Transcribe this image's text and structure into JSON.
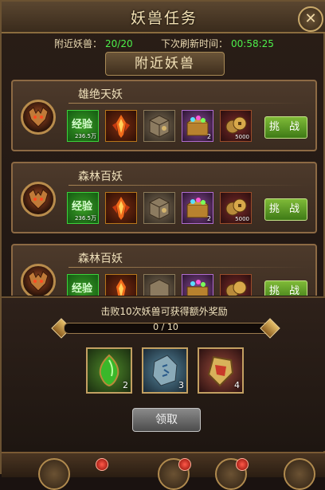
{
  "window": {
    "title": "妖兽任务",
    "close_label": "✕"
  },
  "info": {
    "nearby_label": "附近妖兽：",
    "nearby_value": "20/20",
    "refresh_label": "下次刷新时间：",
    "refresh_value": "00:58:25"
  },
  "section": {
    "title": "附近妖兽"
  },
  "cards": [
    {
      "name": "雄绝天妖",
      "challenge_label": "挑 战",
      "items": [
        {
          "icon": "exp-icon",
          "label": "经验",
          "count": "236.5万"
        },
        {
          "icon": "fire-crystal-icon",
          "count": ""
        },
        {
          "icon": "stone-box-icon",
          "count": ""
        },
        {
          "icon": "gem-chest-icon",
          "count": "2"
        },
        {
          "icon": "coin-icon",
          "count": "5000"
        }
      ]
    },
    {
      "name": "森林百妖",
      "challenge_label": "挑 战",
      "items": [
        {
          "icon": "exp-icon",
          "label": "经验",
          "count": "236.5万"
        },
        {
          "icon": "fire-crystal-icon",
          "count": ""
        },
        {
          "icon": "stone-box-icon",
          "count": ""
        },
        {
          "icon": "gem-chest-icon",
          "count": "2"
        },
        {
          "icon": "coin-icon",
          "count": "5000"
        }
      ]
    },
    {
      "name": "森林百妖",
      "challenge_label": "挑 战",
      "items": [
        {
          "icon": "exp-icon",
          "label": "经验",
          "count": ""
        },
        {
          "icon": "fire-crystal-icon",
          "count": ""
        },
        {
          "icon": "stone-box-icon",
          "count": ""
        },
        {
          "icon": "gem-chest-icon",
          "count": ""
        },
        {
          "icon": "coin-icon",
          "count": ""
        }
      ]
    }
  ],
  "reward": {
    "title": "击败10次妖兽可获得额外奖励",
    "progress_text": "0 / 10",
    "progress_fraction": 0,
    "items": [
      {
        "icon": "green-gem-icon",
        "count": "2"
      },
      {
        "icon": "rune-stone-icon",
        "count": "3"
      },
      {
        "icon": "badge-icon",
        "count": "4"
      }
    ],
    "claim_label": "领取"
  },
  "colors": {
    "accent_green": "#4df04a",
    "gold": "#c8a86a",
    "challenge_green": "#5f9a26"
  }
}
